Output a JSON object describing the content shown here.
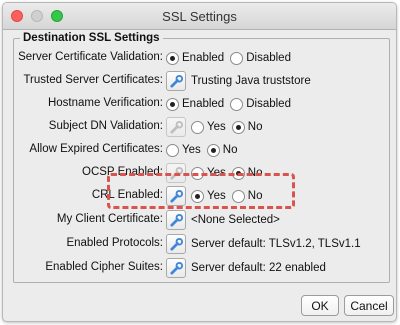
{
  "window": {
    "title": "SSL Settings"
  },
  "group": {
    "legend": "Destination SSL Settings"
  },
  "rows": {
    "server_cert_validation": {
      "label": "Server Certificate Validation:",
      "options": [
        "Enabled",
        "Disabled"
      ],
      "selected": "Enabled"
    },
    "trusted_server_certs": {
      "label": "Trusted Server Certificates:",
      "value": "Trusting Java truststore",
      "icon": "wrench-icon"
    },
    "hostname_verification": {
      "label": "Hostname Verification:",
      "options": [
        "Enabled",
        "Disabled"
      ],
      "selected": "Enabled"
    },
    "subject_dn_validation": {
      "label": "Subject DN Validation:",
      "options": [
        "Yes",
        "No"
      ],
      "selected": "No"
    },
    "allow_expired_certs": {
      "label": "Allow Expired Certificates:",
      "options": [
        "Yes",
        "No"
      ],
      "selected": "No"
    },
    "ocsp_enabled": {
      "label": "OCSP Enabled:",
      "options": [
        "Yes",
        "No"
      ],
      "selected": "No"
    },
    "crl_enabled": {
      "label": "CRL Enabled:",
      "options": [
        "Yes",
        "No"
      ],
      "selected": "Yes"
    },
    "my_client_cert": {
      "label": "My Client Certificate:",
      "value": "<None Selected>"
    },
    "enabled_protocols": {
      "label": "Enabled Protocols:",
      "value": "Server default: TLSv1.2, TLSv1.1"
    },
    "enabled_cipher_suites": {
      "label": "Enabled Cipher Suites:",
      "value": "Server default: 22 enabled"
    }
  },
  "buttons": {
    "ok": "OK",
    "cancel": "Cancel"
  },
  "colors": {
    "highlight": "#d9534f",
    "icon_blue": "#3f86d9"
  }
}
